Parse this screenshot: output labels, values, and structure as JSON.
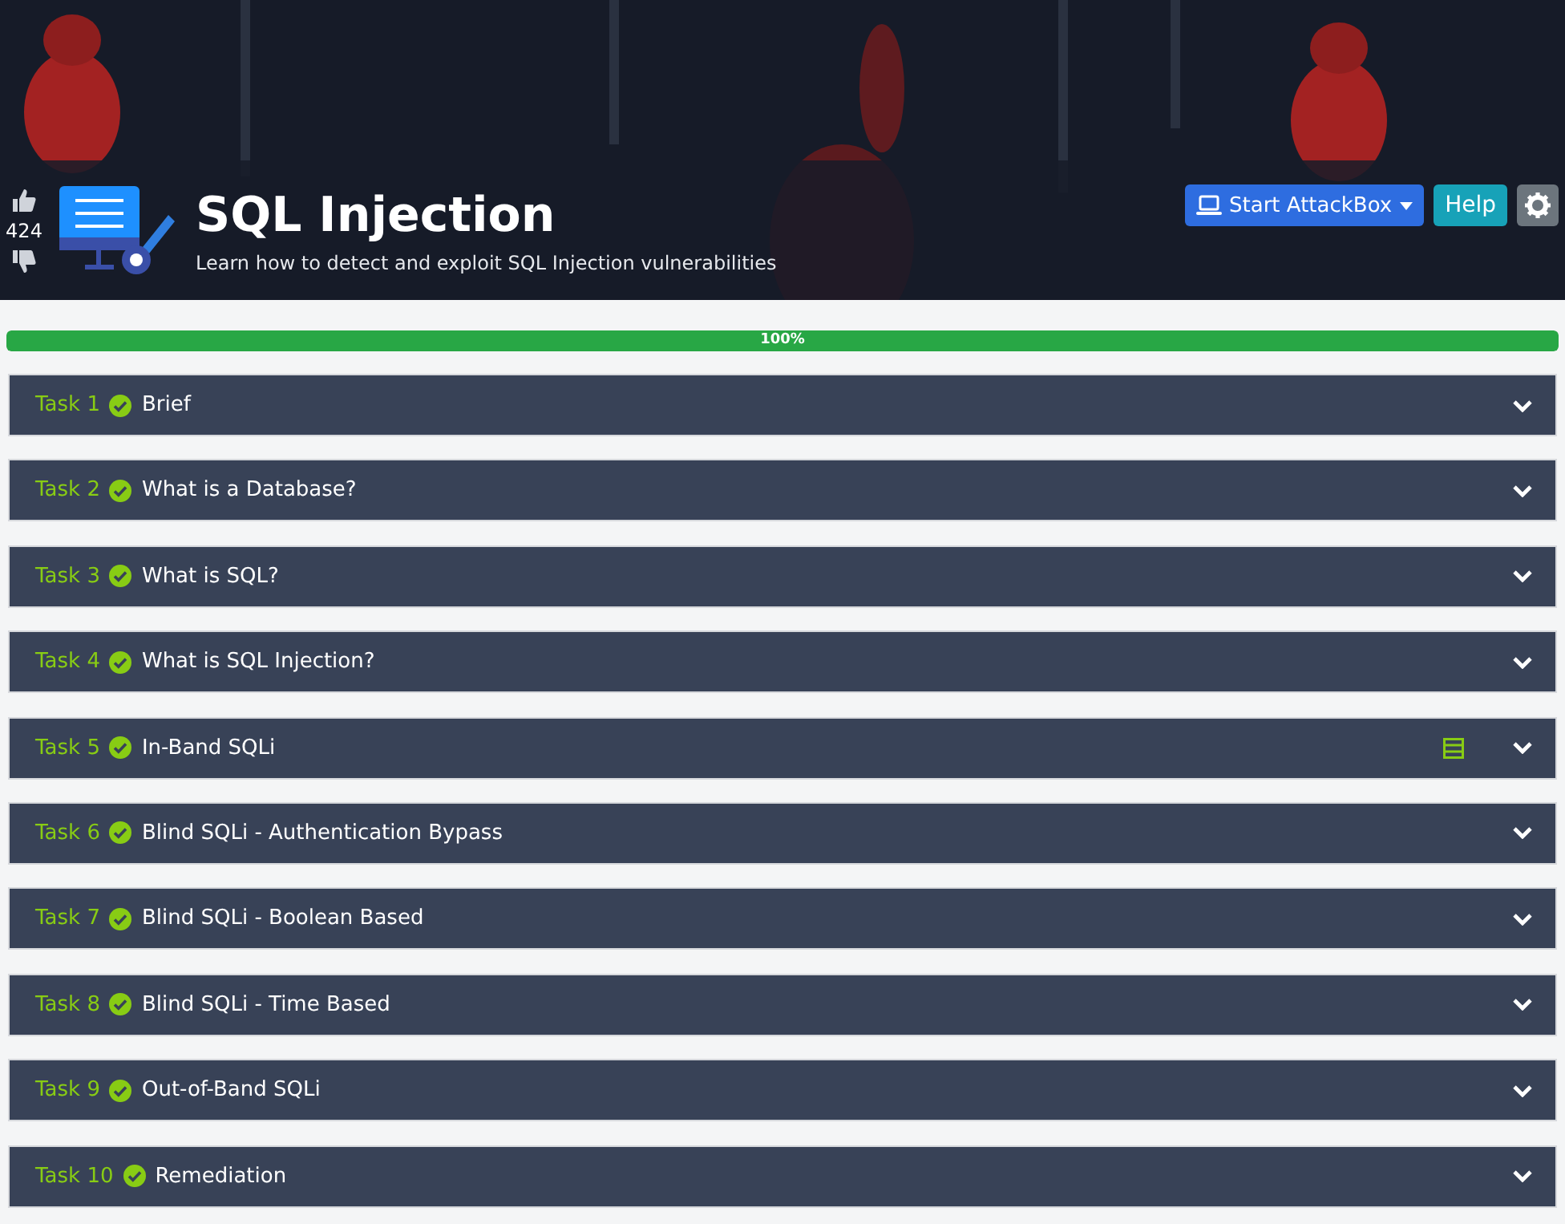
{
  "room": {
    "votes": "424",
    "title": "SQL Injection",
    "subtitle": "Learn how to detect and exploit SQL Injection vulnerabilities"
  },
  "actions": {
    "attackbox": "Start AttackBox",
    "help": "Help"
  },
  "progress": {
    "level": 1,
    "label": "100%"
  },
  "tasks": [
    {
      "number": "Task 1",
      "title": "Brief",
      "completed": true,
      "machine": false
    },
    {
      "number": "Task 2",
      "title": "What is a Database?",
      "completed": true,
      "machine": false
    },
    {
      "number": "Task 3",
      "title": "What is SQL?",
      "completed": true,
      "machine": false
    },
    {
      "number": "Task 4",
      "title": "What is SQL Injection?",
      "completed": true,
      "machine": false
    },
    {
      "number": "Task 5",
      "title": "In-Band SQLi",
      "completed": true,
      "machine": true
    },
    {
      "number": "Task 6",
      "title": "Blind SQLi - Authentication Bypass",
      "completed": true,
      "machine": false
    },
    {
      "number": "Task 7",
      "title": "Blind SQLi - Boolean Based",
      "completed": true,
      "machine": false
    },
    {
      "number": "Task 8",
      "title": "Blind SQLi - Time Based",
      "completed": true,
      "machine": false
    },
    {
      "number": "Task 9",
      "title": "Out-of-Band SQLi",
      "completed": true,
      "machine": false
    },
    {
      "number": "Task 10",
      "title": "Remediation",
      "completed": true,
      "machine": false
    }
  ]
}
